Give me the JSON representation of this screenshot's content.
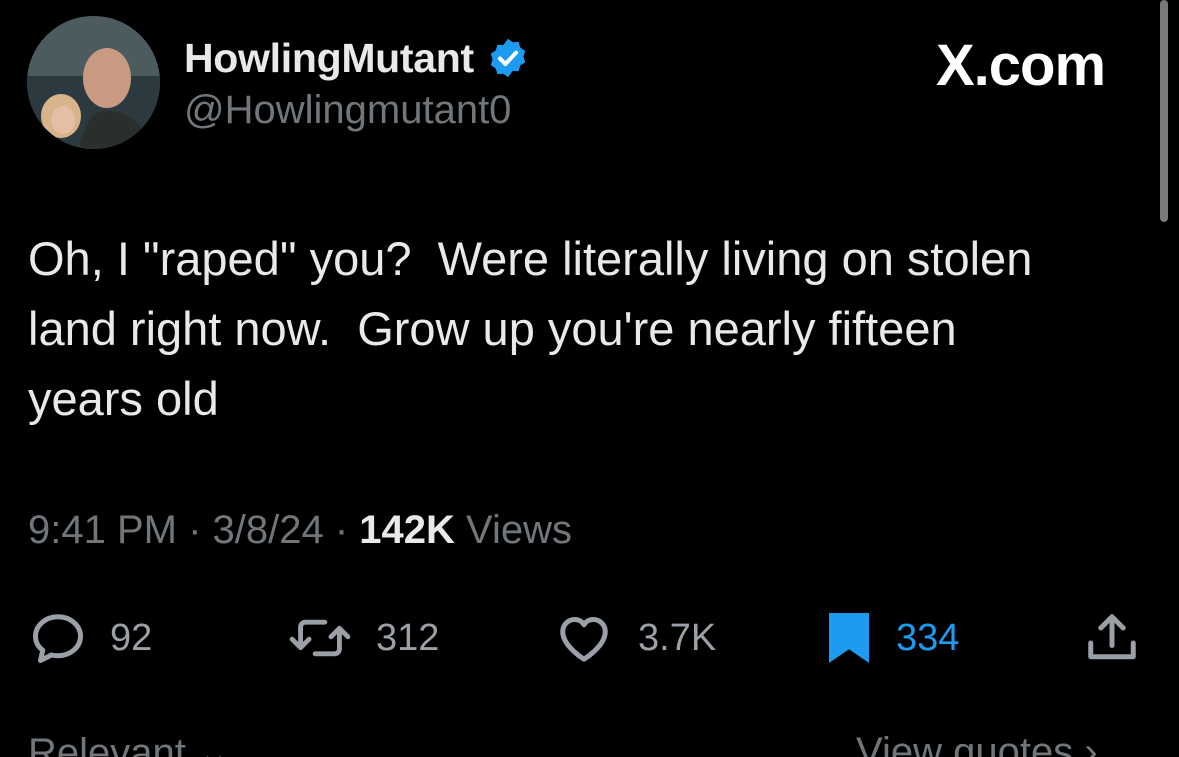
{
  "header": {
    "display_name": "HowlingMutant",
    "handle": "@Howlingmutant0",
    "site_logo_text": "X.com",
    "verified_icon": "verified-badge-icon"
  },
  "tweet": {
    "text": "Oh, I \"raped\" you?  Were literally living on stolen\nland right now.  Grow up you're nearly fifteen\nyears old",
    "time": "9:41 PM",
    "separator": " · ",
    "date": "3/8/24",
    "views_count": "142K",
    "views_label": " Views"
  },
  "actions": {
    "replies": {
      "icon": "reply-icon",
      "count": "92"
    },
    "reposts": {
      "icon": "repost-icon",
      "count": "312"
    },
    "likes": {
      "icon": "heart-icon",
      "count": "3.7K"
    },
    "bookmarks": {
      "icon": "bookmark-filled-icon",
      "count": "334"
    },
    "share": {
      "icon": "share-icon"
    }
  },
  "footer": {
    "left_label": "Relevant ⌄",
    "right_label": "View quotes ›"
  },
  "colors": {
    "background": "#000000",
    "text_primary": "#e7e9ea",
    "text_secondary": "#71767b",
    "accent_blue": "#1d9bf0"
  }
}
